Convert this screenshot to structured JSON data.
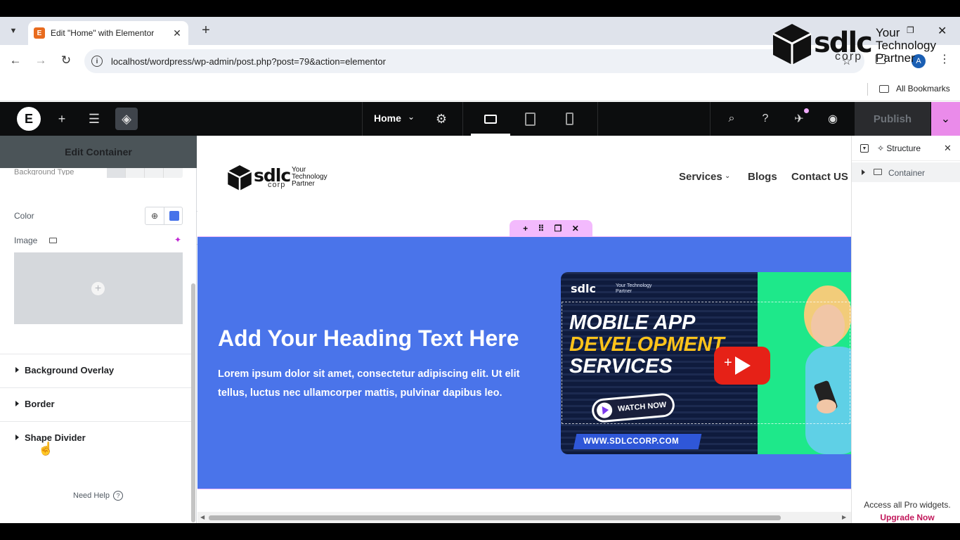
{
  "browser": {
    "tab_title": "Edit \"Home\" with Elementor",
    "tab_close": "✕",
    "new_tab": "+",
    "url": "localhost/wordpress/wp-admin/post.php?post=79&action=elementor",
    "profile_initial": "A",
    "bookmarks_label": "All Bookmarks",
    "window_close": "✕"
  },
  "watermark": {
    "brand": "sdlc",
    "sub": "corp",
    "tagline": "Your Technology Partner"
  },
  "elementor_bar": {
    "page_name": "Home",
    "publish_label": "Publish"
  },
  "left_panel": {
    "header": "Edit Container",
    "background_type_label": "Background Type",
    "color_label": "Color",
    "color_value": "#4672ea",
    "image_label": "Image",
    "sections": [
      "Background Overlay",
      "Border",
      "Shape Divider"
    ],
    "need_help": "Need Help"
  },
  "site": {
    "logo_brand": "sdlc",
    "logo_sub": "corp",
    "logo_tagline": "Your Technology Partner",
    "nav": [
      "Services",
      "Blogs",
      "Contact US"
    ],
    "hero_heading": "Add Your Heading Text Here",
    "hero_text": "Lorem ipsum dolor sit amet, consectetur adipiscing elit. Ut elit tellus, luctus nec ullamcorper mattis, pulvinar dapibus leo.",
    "hero_bg": "#4a74ea"
  },
  "thumbnail": {
    "brand": "sdlc",
    "tagline": "Your Technology Partner",
    "line1": "MOBILE APP",
    "line2": "DEVELOPMENT",
    "line3": "SERVICES",
    "watch_now": "WATCH NOW",
    "url": "WWW.SDLCCORP.COM"
  },
  "structure_panel": {
    "title": "Structure",
    "item": "Container",
    "upgrade_text": "Access all Pro widgets.",
    "upgrade_link": "Upgrade Now"
  }
}
